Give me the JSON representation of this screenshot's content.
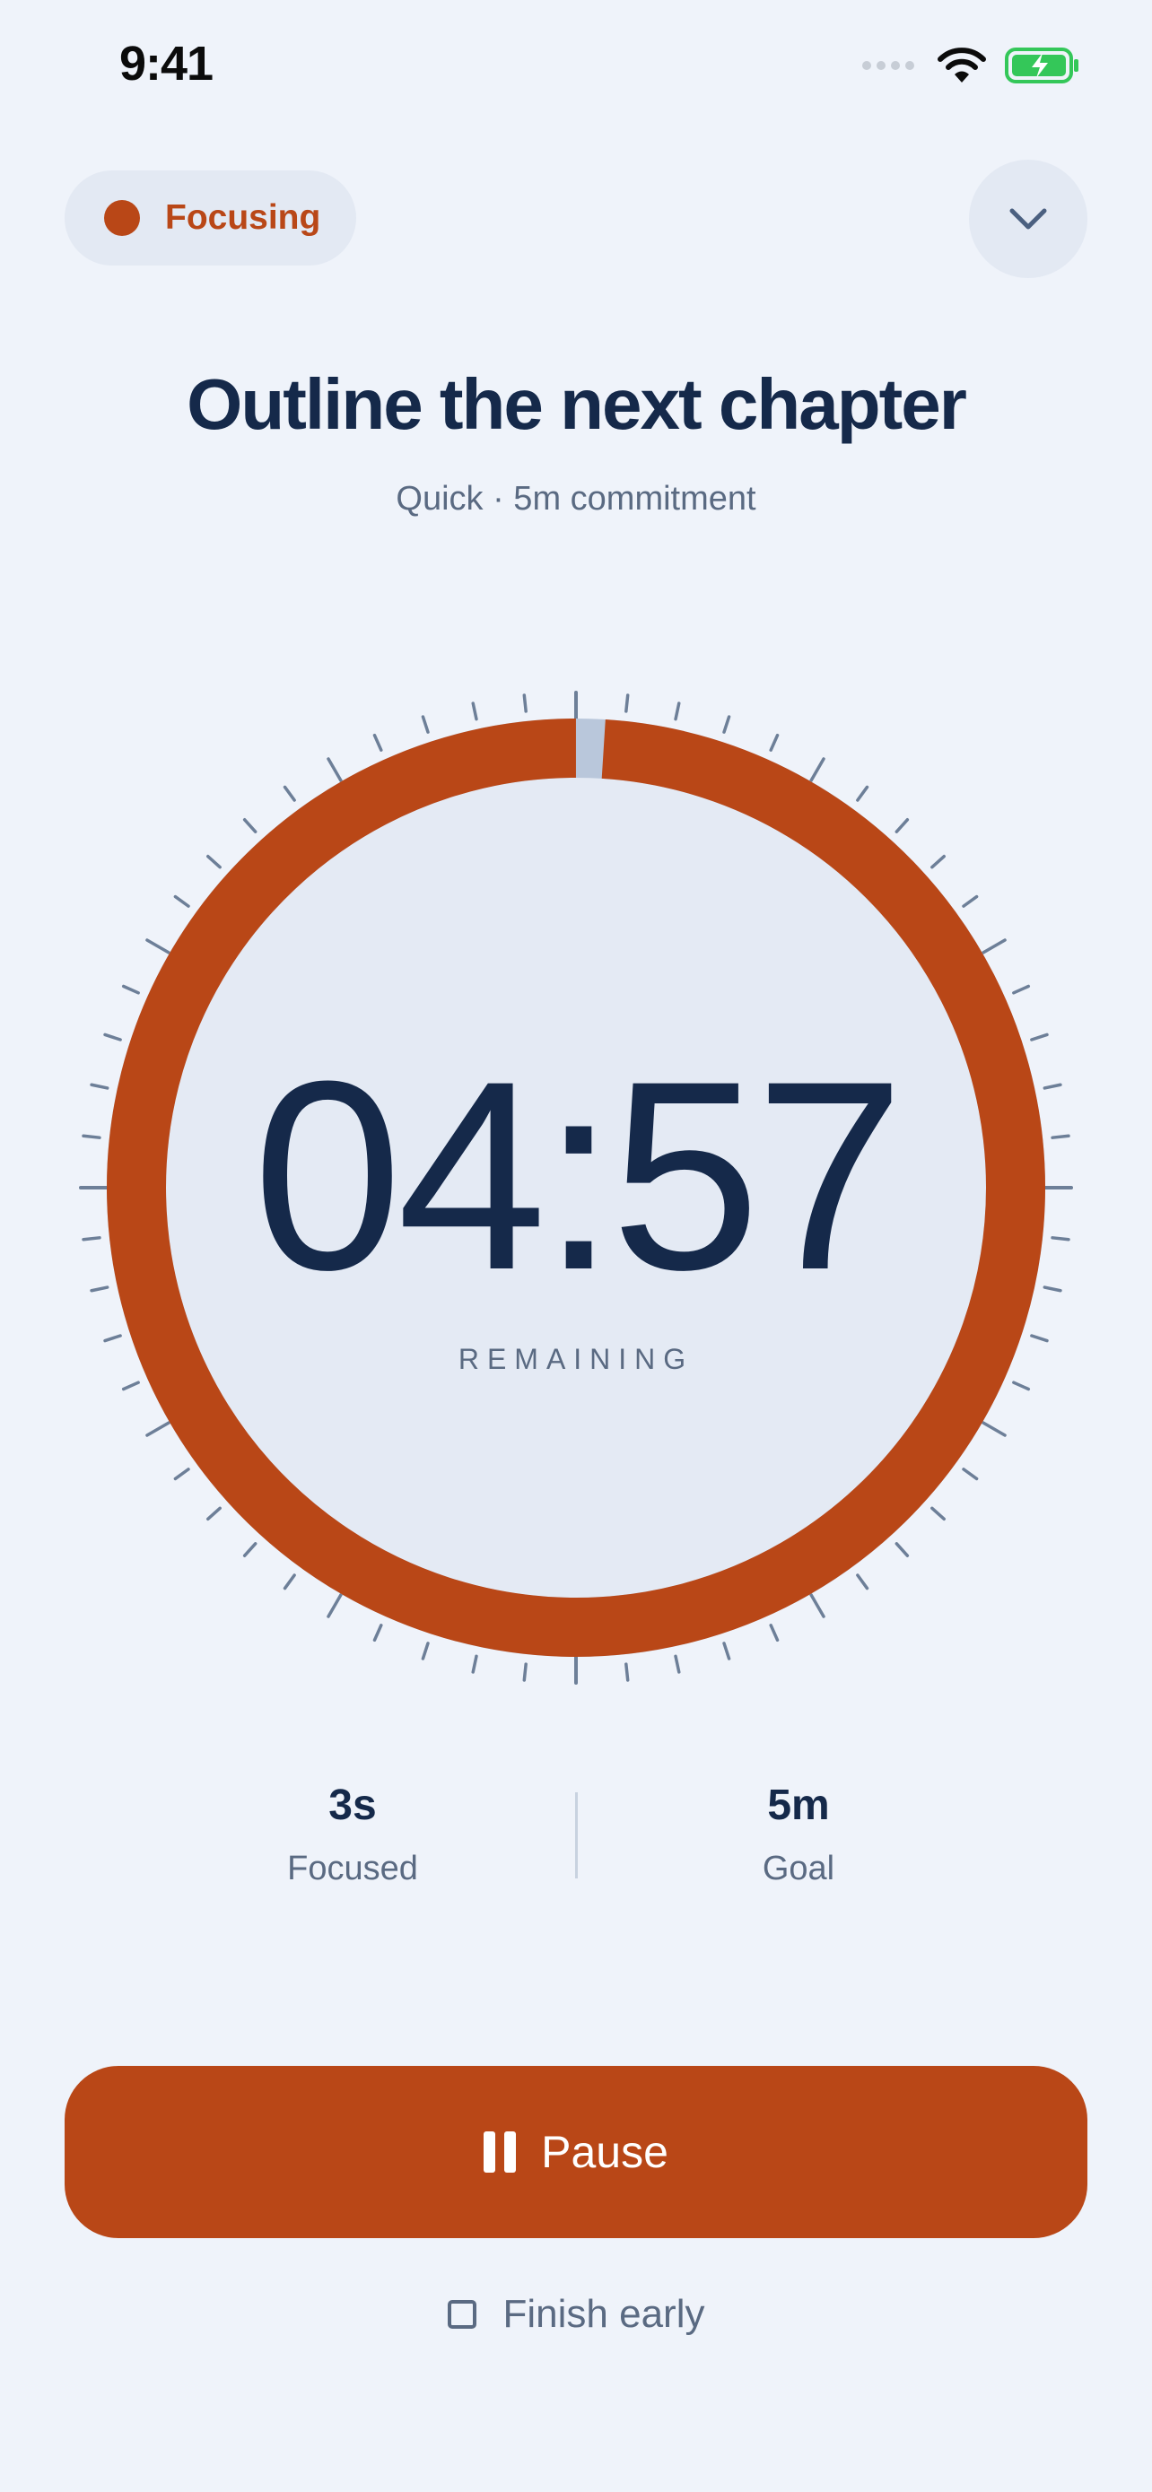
{
  "status_bar": {
    "time": "9:41",
    "icons": [
      "signal-dots-icon",
      "wifi-icon",
      "battery-charging-icon"
    ],
    "battery_color": "#34c759"
  },
  "header": {
    "status_label": "Focusing",
    "status_color": "#b94717",
    "collapse_icon": "chevron-down-icon"
  },
  "task": {
    "title": "Outline the next chapter",
    "subtitle": "Quick · 5m commitment"
  },
  "timer": {
    "time_remaining": "04:57",
    "remaining_label": "REMAINING",
    "progress_fraction": 0.01,
    "ring_color": "#b94717",
    "ring_track_color": "#b9c7db",
    "face_color": "#e4eaf4"
  },
  "stats": {
    "focused": {
      "value": "3s",
      "label": "Focused"
    },
    "goal": {
      "value": "5m",
      "label": "Goal"
    }
  },
  "actions": {
    "pause_label": "Pause",
    "pause_icon": "pause-icon",
    "finish_early_label": "Finish early"
  },
  "colors": {
    "background": "#eff3fa",
    "accent": "#b94717",
    "text_primary": "#15294a",
    "text_secondary": "#5a6a82"
  }
}
